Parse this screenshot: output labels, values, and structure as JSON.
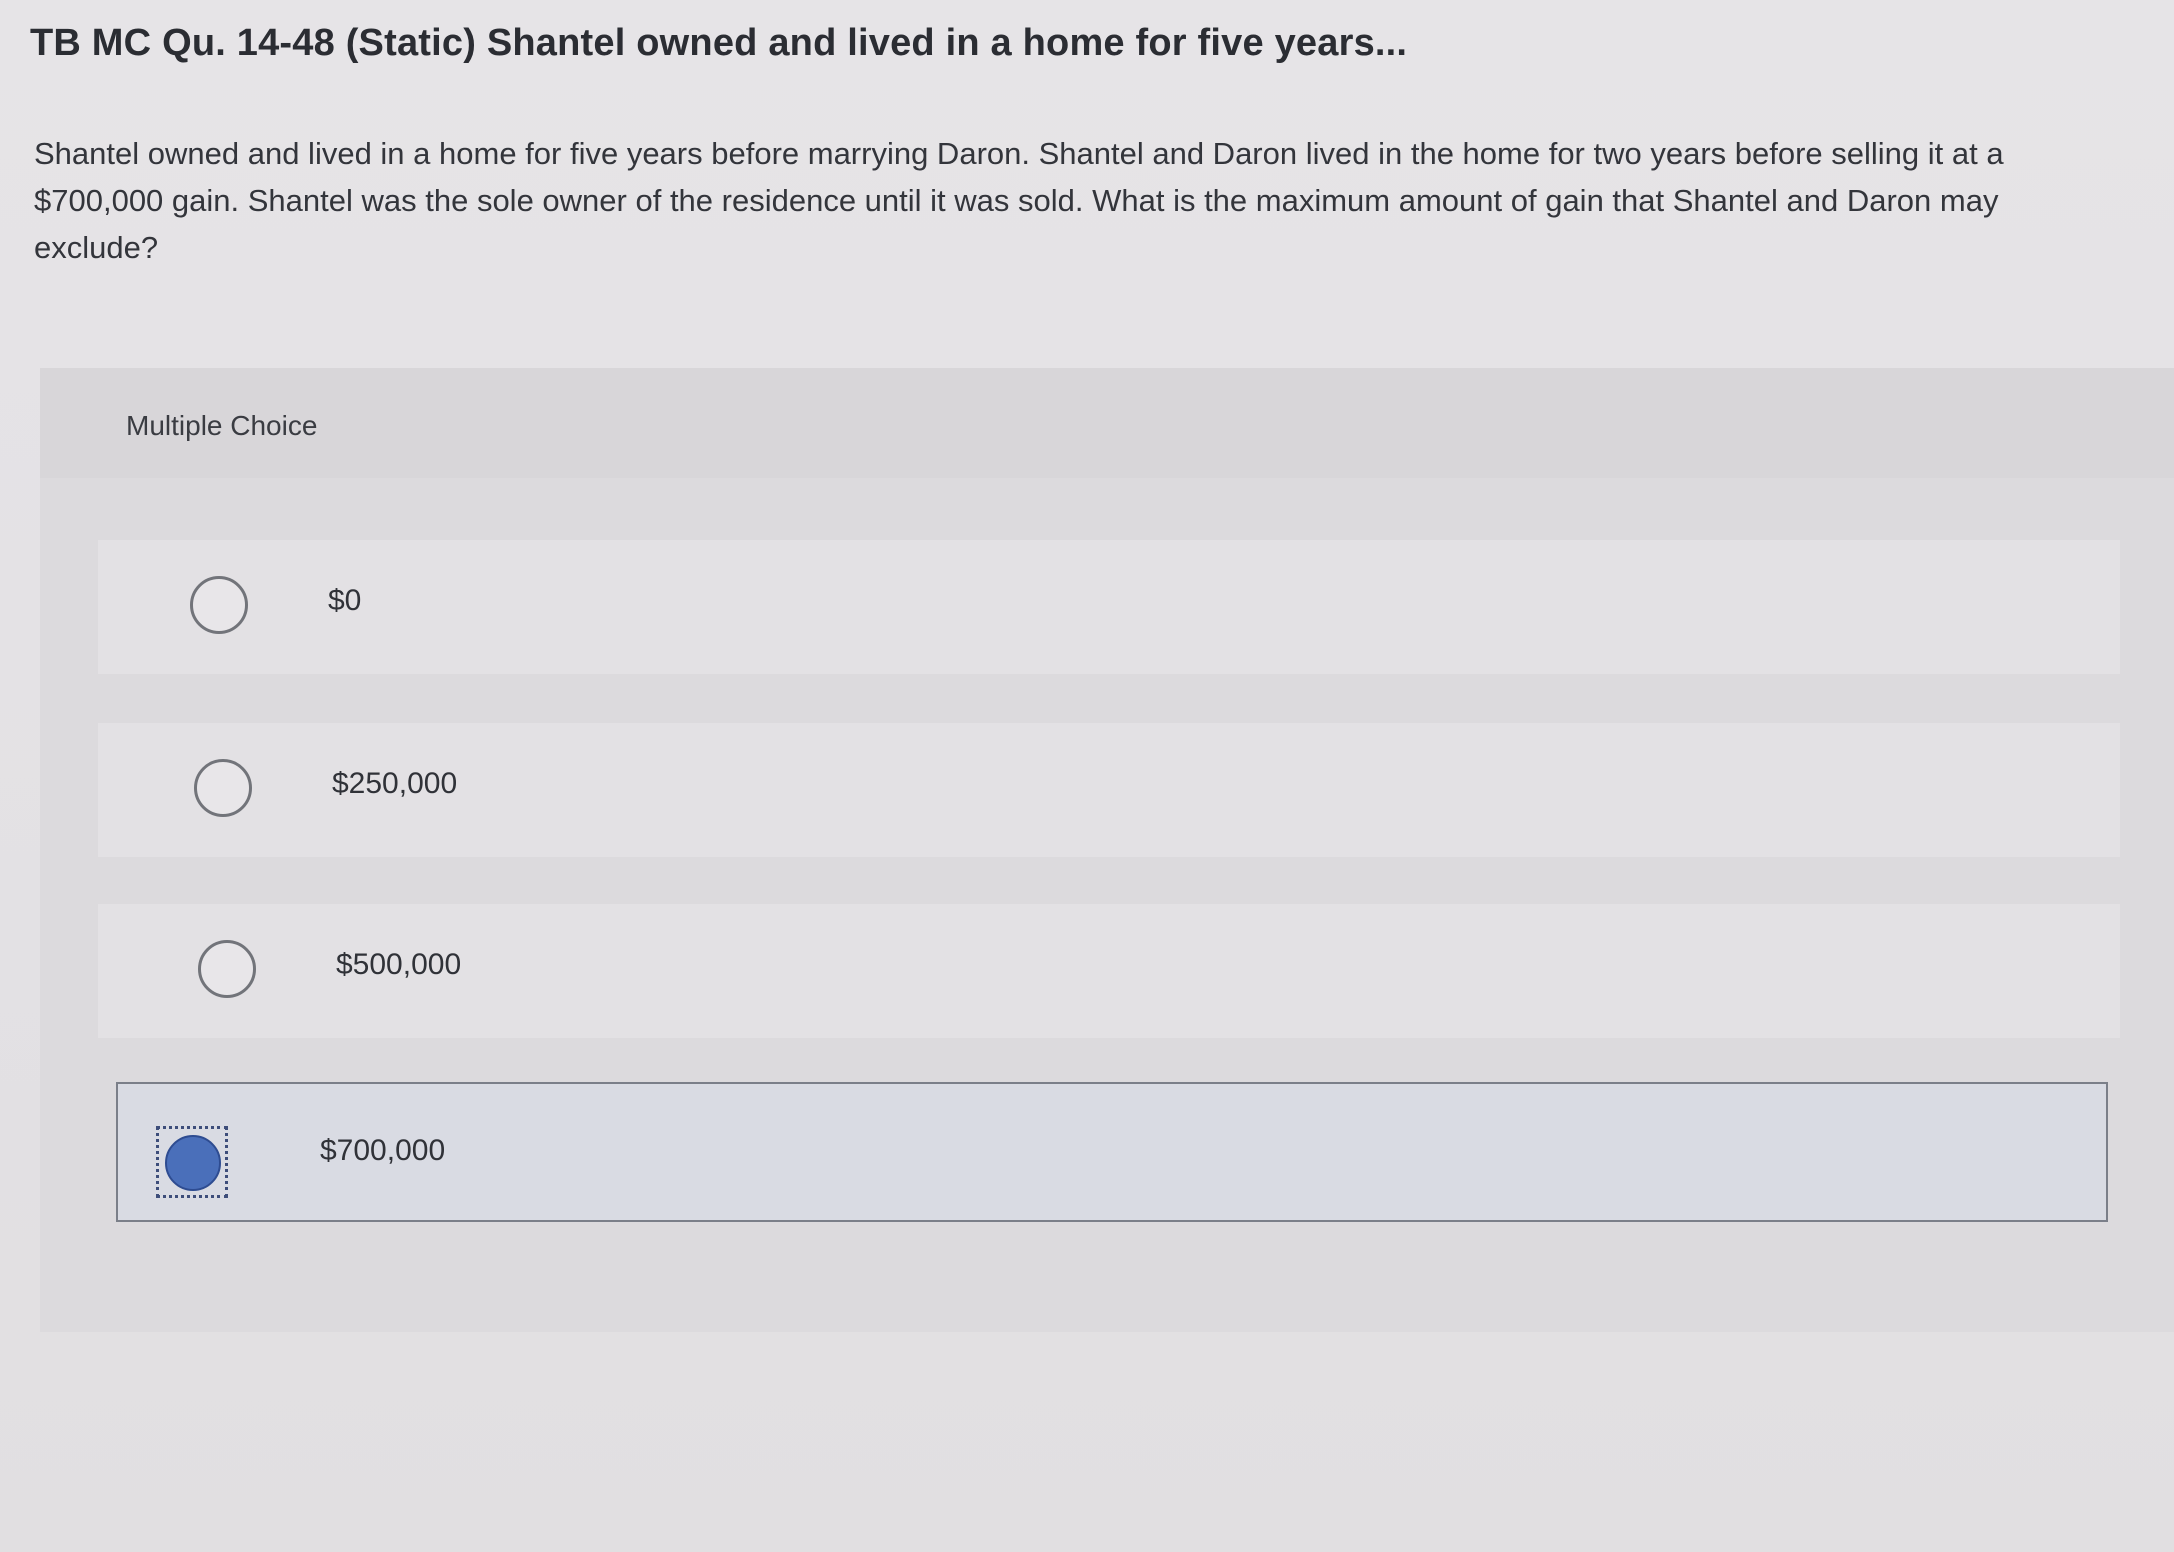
{
  "question": {
    "title": "TB MC Qu. 14-48 (Static) Shantel owned and lived in a home for five years...",
    "body": "Shantel owned and lived in a home for five years before marrying Daron. Shantel and Daron lived in the home for two years before selling it at a $700,000 gain. Shantel was the sole owner of the residence until it was sold. What is the maximum amount of gain that Shantel and Daron may exclude?"
  },
  "multiple_choice": {
    "label": "Multiple Choice",
    "options": [
      {
        "label": "$0",
        "selected": false
      },
      {
        "label": "$250,000",
        "selected": false
      },
      {
        "label": "$500,000",
        "selected": false
      },
      {
        "label": "$700,000",
        "selected": true
      }
    ]
  },
  "colors": {
    "background": "#e4e2e5",
    "selected_fill": "#4a6fba",
    "selected_row": "#d9dbe3"
  }
}
